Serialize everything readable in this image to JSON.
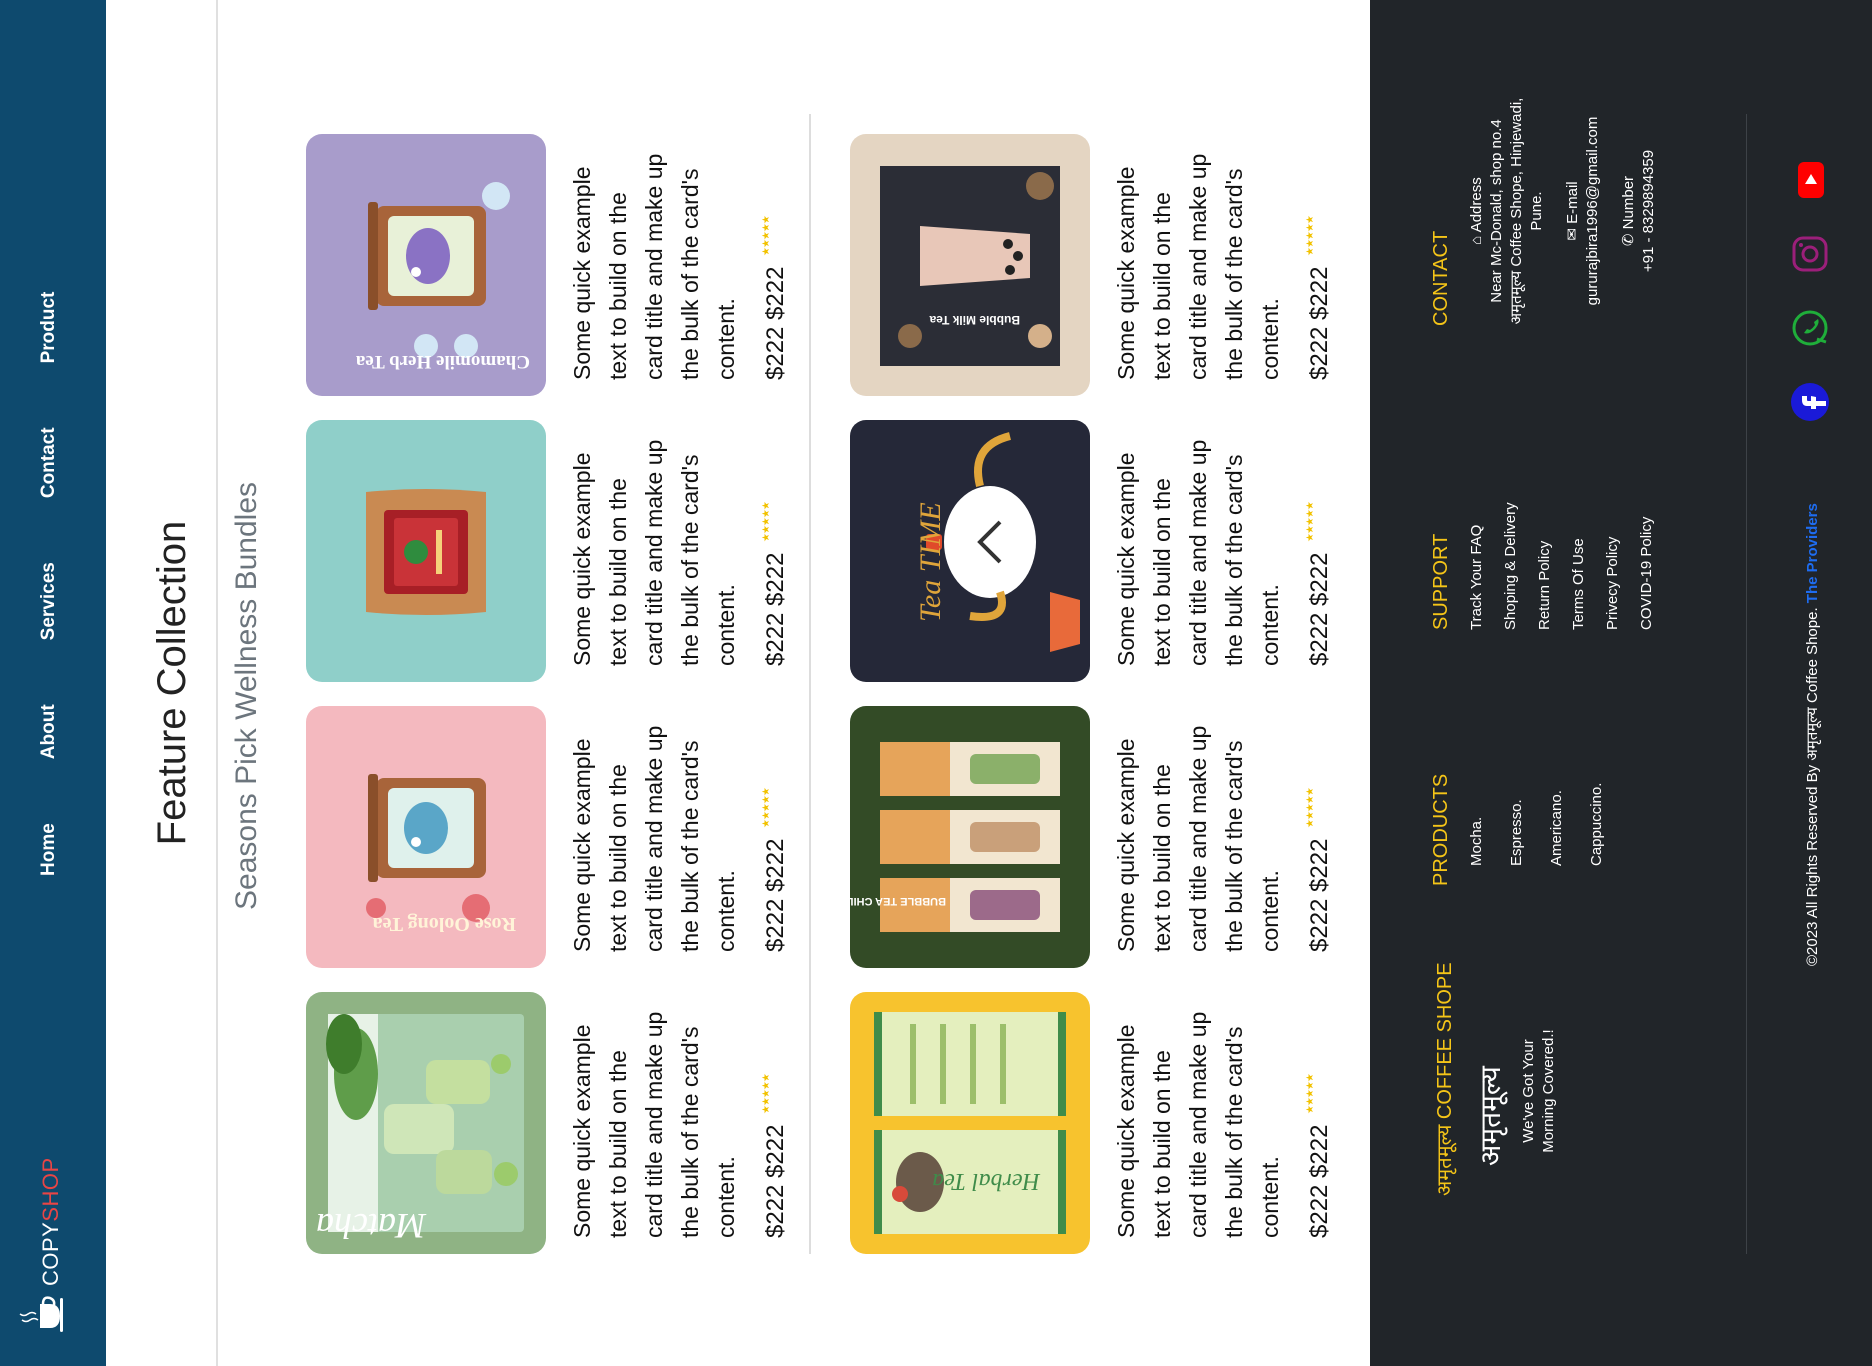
{
  "navbar": {
    "brand_prefix": "COPY",
    "brand_highlight": "SHOP",
    "links": [
      "Home",
      "About",
      "Services",
      "Contact",
      "Product"
    ]
  },
  "section": {
    "title": "Feature Collection",
    "subtitle": "Seasons Pick Wellness Bundles"
  },
  "cards": [
    {
      "image": "matcha-signature-poster",
      "image_text": "Matcha",
      "text": "Some quick example text to build on the card title and make up the bulk of the card's content.",
      "price": "$222 $222",
      "stars": "★★★★★"
    },
    {
      "image": "rose-oolong-tea-tin",
      "image_text": "Rose Oolong Tea",
      "text": "Some quick example text to build on the card title and make up the bulk of the card's content.",
      "price": "$222 $222",
      "stars": "★★★★★"
    },
    {
      "image": "orange-licorice-tea-pouch",
      "image_text": "",
      "text": "Some quick example text to build on the card title and make up the bulk of the card's content.",
      "price": "$222 $222",
      "stars": "★★★★★"
    },
    {
      "image": "chamomile-herb-tea-tin",
      "image_text": "Chamomile Herb Tea",
      "text": "Some quick example text to build on the card title and make up the bulk of the card's content.",
      "price": "$222 $222",
      "stars": "★★★★★"
    },
    {
      "image": "herbal-tea-menu",
      "image_text": "Herbal Tea",
      "text": "Some quick example text to build on the card title and make up the bulk of the card's content.",
      "price": "$222 $222",
      "stars": "★★★★★"
    },
    {
      "image": "bubble-tea-banners",
      "image_text": "BUBBLE TEA CHILL",
      "text": "Some quick example text to build on the card title and make up the bulk of the card's content.",
      "price": "$222 $222",
      "stars": "★★★★★"
    },
    {
      "image": "tea-time-teapot",
      "image_text": "Tea TIME",
      "text": "Some quick example text to build on the card title and make up the bulk of the card's content.",
      "price": "$222 $222",
      "stars": "★★★★★"
    },
    {
      "image": "bubble-milk-tea",
      "image_text": "Bubble Milk Tea",
      "text": "Some quick example text to build on the card title and make up the bulk of the card's content.",
      "price": "$222 $222",
      "stars": "★★★★★"
    }
  ],
  "footer": {
    "brand_heading": "अमृतमूल्य COFFEE SHOPE",
    "brand_logo": "अमृतमूल्य",
    "tagline": "We've Got Your Morning Covered.!",
    "products_heading": "PRODUCTS",
    "products": [
      "Mocha.",
      "Espresso.",
      "Americano.",
      "Cappuccino."
    ],
    "support_heading": "SUPPORT",
    "support": [
      "Track Your FAQ",
      "Shoping & Delivery",
      "Return Policy",
      "Terms Of Use",
      "Privecy Policy",
      "COVID-19 Policy"
    ],
    "contact_heading": "CONTACT",
    "address_label": "Address",
    "address": "Near Mc-Donald, shop no.4 अमृतमूल्य Coffee Shope, Hinjewadi, Pune.",
    "email_label": "E-mail",
    "email": "gururajbira1996@gmail.com",
    "phone_label": "Number",
    "phone": "+91 - 8329894359",
    "copyright": "©2023 All Rights Reserved By अमृतमूल्य Coffee Shope.",
    "credit": "The Providers",
    "social": [
      "facebook-icon",
      "whatsapp-icon",
      "instagram-icon",
      "youtube-icon"
    ]
  },
  "colors": {
    "navbar": "#0e4a6e",
    "footer": "#212529",
    "accent": "#f5c518",
    "brand_highlight": "#e84545",
    "credit_link": "#1e6cf0"
  }
}
